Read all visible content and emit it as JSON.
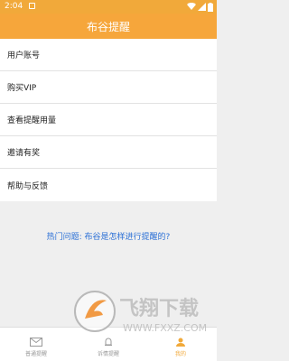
{
  "status_bar": {
    "time": "2:04"
  },
  "app_bar": {
    "title": "布谷提醒"
  },
  "menu": [
    {
      "label": "用户账号"
    },
    {
      "label": "购买VIP"
    },
    {
      "label": "查看提醒用量"
    },
    {
      "label": "邀请有奖"
    },
    {
      "label": "帮助与反馈"
    }
  ],
  "faq": {
    "text": "热门问题: 布谷是怎样进行提醒的?"
  },
  "bottom_nav": {
    "tabs": [
      {
        "label": "普通提醒",
        "icon": "envelope-icon",
        "active": false
      },
      {
        "label": "诉情提醒",
        "icon": "bell-icon",
        "active": false
      },
      {
        "label": "我的",
        "icon": "user-icon",
        "active": true
      }
    ]
  },
  "watermark": {
    "text": "飞翔下载",
    "subtext": "WWW.FXXZ.COM"
  },
  "colors": {
    "primary": "#f6a63b",
    "link": "#2a6fd6",
    "background": "#efefef"
  }
}
